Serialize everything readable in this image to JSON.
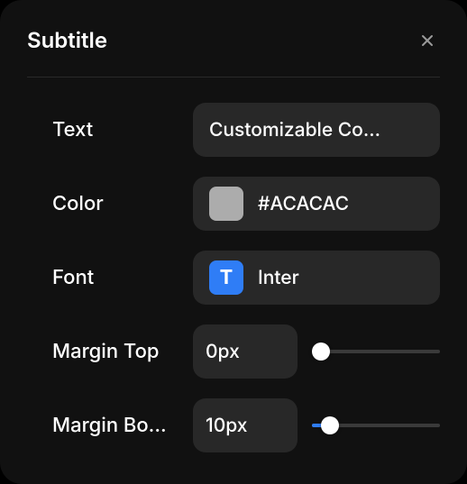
{
  "panel": {
    "title": "Subtitle"
  },
  "rows": {
    "text": {
      "label": "Text",
      "value": "Customizable Co..."
    },
    "color": {
      "label": "Color",
      "value": "#ACACAC",
      "swatch": "#ACACAC"
    },
    "font": {
      "label": "Font",
      "value": "Inter",
      "badge": "T"
    },
    "margin_top": {
      "label": "Margin Top",
      "value": "0px",
      "slider_percent": 0
    },
    "margin_bottom": {
      "label": "Margin Bo...",
      "value": "10px",
      "slider_percent": 12
    }
  },
  "icons": {
    "close": "close-icon"
  }
}
